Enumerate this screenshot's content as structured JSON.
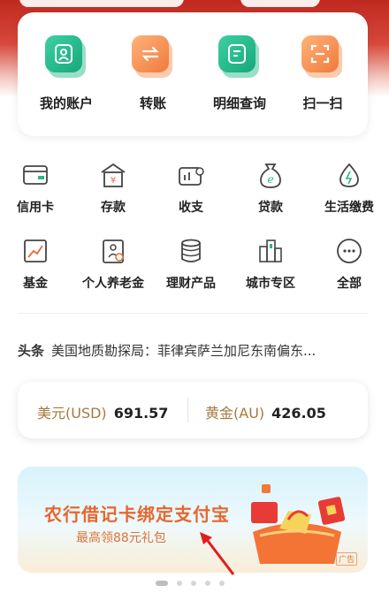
{
  "quick_actions": [
    {
      "label": "我的账户",
      "icon": "account-icon",
      "color": "green"
    },
    {
      "label": "转账",
      "icon": "transfer-icon",
      "color": "orange"
    },
    {
      "label": "明细查询",
      "icon": "statement-icon",
      "color": "green"
    },
    {
      "label": "扫一扫",
      "icon": "scan-icon",
      "color": "orange"
    }
  ],
  "services": [
    {
      "label": "信用卡",
      "icon": "credit-card-icon"
    },
    {
      "label": "存款",
      "icon": "deposit-icon"
    },
    {
      "label": "收支",
      "icon": "income-expense-icon"
    },
    {
      "label": "贷款",
      "icon": "loan-icon"
    },
    {
      "label": "生活缴费",
      "icon": "utility-bill-icon"
    },
    {
      "label": "基金",
      "icon": "fund-icon"
    },
    {
      "label": "个人养老金",
      "icon": "pension-icon"
    },
    {
      "label": "理财产品",
      "icon": "wealth-icon"
    },
    {
      "label": "城市专区",
      "icon": "city-icon"
    },
    {
      "label": "全部",
      "icon": "more-icon"
    }
  ],
  "news": {
    "tag": "头条",
    "text": "美国地质勘探局：菲律宾萨兰加尼东南偏东..."
  },
  "rates": {
    "usd_label": "美元(USD)",
    "usd_value": "691.57",
    "gold_label": "黄金(AU)",
    "gold_value": "426.05"
  },
  "banner": {
    "title": "农行借记卡绑定支付宝",
    "subtitle": "最高领88元礼包",
    "ad_tag": "广告"
  },
  "colors": {
    "green": "#1db686",
    "orange": "#f07a3b",
    "red": "#c0291f",
    "gold_label": "#a57a3d"
  },
  "carousel": {
    "count": 5,
    "active": 0
  }
}
